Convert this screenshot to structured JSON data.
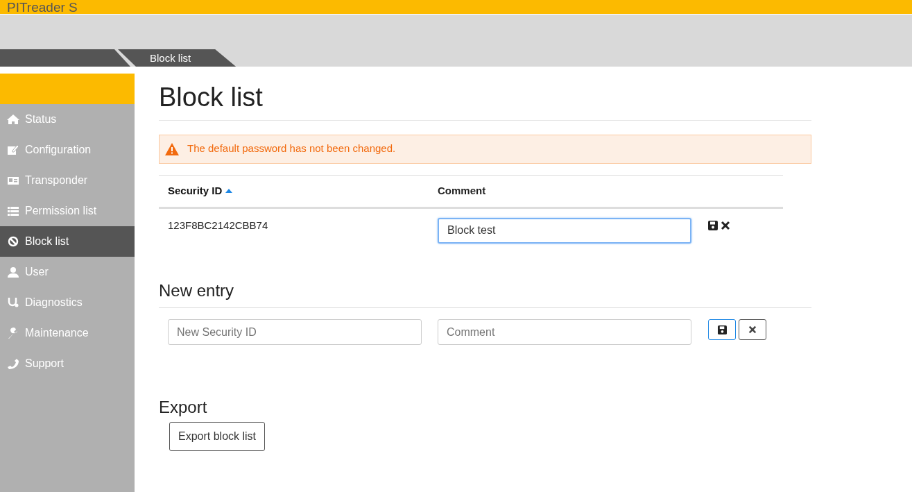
{
  "app_title": "PITreader S",
  "breadcrumb": [
    {
      "label": "Block list"
    }
  ],
  "sidebar": {
    "items": [
      {
        "label": "Status",
        "selected": false
      },
      {
        "label": "Configuration",
        "selected": false
      },
      {
        "label": "Transponder",
        "selected": false
      },
      {
        "label": "Permission list",
        "selected": false
      },
      {
        "label": "Block list",
        "selected": true
      },
      {
        "label": "User",
        "selected": false
      },
      {
        "label": "Diagnostics",
        "selected": false
      },
      {
        "label": "Maintenance",
        "selected": false
      },
      {
        "label": "Support",
        "selected": false
      }
    ]
  },
  "page_title": "Block list",
  "alert": "The default password has not been changed.",
  "table": {
    "columns": [
      {
        "label": "Security ID",
        "sorted": true
      },
      {
        "label": "Comment",
        "sorted": false
      }
    ],
    "rows": [
      {
        "security_id": "123F8BC2142CBB74",
        "comment": "Block test"
      }
    ]
  },
  "new_entry": {
    "title": "New entry",
    "security_id_placeholder": "New Security ID",
    "comment_placeholder": "Comment"
  },
  "export": {
    "title": "Export",
    "button": "Export block list"
  }
}
